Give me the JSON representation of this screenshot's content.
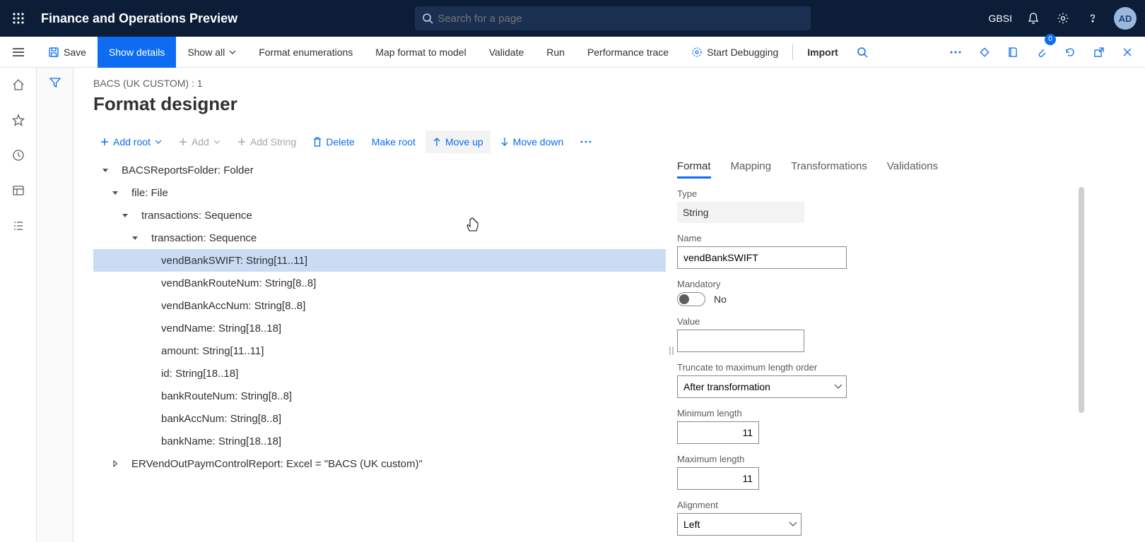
{
  "header": {
    "app_title": "Finance and Operations Preview",
    "search_placeholder": "Search for a page",
    "org": "GBSI",
    "avatar": "AD"
  },
  "cmdbar": {
    "save": "Save",
    "show_details": "Show details",
    "show_all": "Show all",
    "format_enum": "Format enumerations",
    "map_model": "Map format to model",
    "validate": "Validate",
    "run": "Run",
    "perf_trace": "Performance trace",
    "start_debug": "Start Debugging",
    "import": "Import",
    "badge_count": "0"
  },
  "page": {
    "breadcrumb": "BACS (UK CUSTOM) : 1",
    "title": "Format designer"
  },
  "toolbar": {
    "add_root": "Add root",
    "add": "Add",
    "add_string": "Add String",
    "delete": "Delete",
    "make_root": "Make root",
    "move_up": "Move up",
    "move_down": "Move down"
  },
  "tree": [
    {
      "indent": 0,
      "caret": "down",
      "label": "BACSReportsFolder: Folder",
      "sel": false
    },
    {
      "indent": 1,
      "caret": "down",
      "label": "file: File",
      "sel": false
    },
    {
      "indent": 2,
      "caret": "down",
      "label": "transactions: Sequence",
      "sel": false
    },
    {
      "indent": 3,
      "caret": "down",
      "label": "transaction: Sequence",
      "sel": false
    },
    {
      "indent": 4,
      "caret": "",
      "label": "vendBankSWIFT: String[11..11]",
      "sel": true
    },
    {
      "indent": 4,
      "caret": "",
      "label": "vendBankRouteNum: String[8..8]",
      "sel": false
    },
    {
      "indent": 4,
      "caret": "",
      "label": "vendBankAccNum: String[8..8]",
      "sel": false
    },
    {
      "indent": 4,
      "caret": "",
      "label": "vendName: String[18..18]",
      "sel": false
    },
    {
      "indent": 4,
      "caret": "",
      "label": "amount: String[11..11]",
      "sel": false
    },
    {
      "indent": 4,
      "caret": "",
      "label": "id: String[18..18]",
      "sel": false
    },
    {
      "indent": 4,
      "caret": "",
      "label": "bankRouteNum: String[8..8]",
      "sel": false
    },
    {
      "indent": 4,
      "caret": "",
      "label": "bankAccNum: String[8..8]",
      "sel": false
    },
    {
      "indent": 4,
      "caret": "",
      "label": "bankName: String[18..18]",
      "sel": false
    },
    {
      "indent": 1,
      "caret": "right",
      "label": "ERVendOutPaymControlReport: Excel = \"BACS (UK custom)\"",
      "sel": false
    }
  ],
  "tabs": {
    "format": "Format",
    "mapping": "Mapping",
    "transform": "Transformations",
    "valid": "Validations"
  },
  "props": {
    "type_label": "Type",
    "type_value": "String",
    "name_label": "Name",
    "name_value": "vendBankSWIFT",
    "mandatory_label": "Mandatory",
    "mandatory_value": "No",
    "value_label": "Value",
    "value_value": "",
    "truncate_label": "Truncate to maximum length order",
    "truncate_value": "After transformation",
    "min_label": "Minimum length",
    "min_value": "11",
    "max_label": "Maximum length",
    "max_value": "11",
    "align_label": "Alignment",
    "align_value": "Left"
  }
}
